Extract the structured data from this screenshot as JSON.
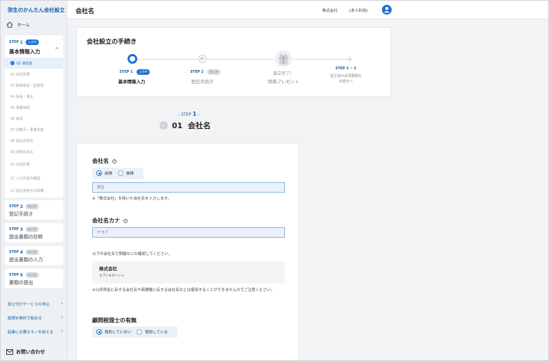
{
  "sidebar": {
    "brand": "弥生のかんたん会社設立",
    "home": "ホーム",
    "step1": {
      "step": "STEP",
      "num": "1",
      "badge": "入力中",
      "title": "基本情報入力",
      "chevron": "^"
    },
    "items": [
      {
        "label": "01 会社名",
        "check": "✓"
      },
      {
        "label": "02 会社形態"
      },
      {
        "label": "03 取締役会・監査役"
      },
      {
        "label": "04 役員・株主"
      },
      {
        "label": "05 事業目的"
      },
      {
        "label": "06 株式"
      },
      {
        "label": "07 決算月・事業年度"
      },
      {
        "label": "08 会社の所在"
      },
      {
        "label": "09 定款の定め"
      },
      {
        "label": "10 日割計算"
      },
      {
        "label": "11 入力内容の確認"
      },
      {
        "label": "12 登記手続きの準備"
      }
    ],
    "steps": [
      {
        "step": "STEP",
        "num": "2",
        "badge": "未入力",
        "title": "登記手続き"
      },
      {
        "step": "STEP",
        "num": "3",
        "badge": "未入力",
        "title": "提出書類の診断"
      },
      {
        "step": "STEP",
        "num": "4",
        "badge": "未入力",
        "title": "提出書類の入力"
      },
      {
        "step": "STEP",
        "num": "5",
        "badge": "未入力",
        "title": "書類の提出"
      }
    ],
    "links": [
      {
        "label": "設立代行サービスの申込",
        "arrow": "›"
      },
      {
        "label": "経理を無料で始める",
        "arrow": "›"
      },
      {
        "label": "起業に必要なモノを揃える",
        "arrow": "›"
      }
    ],
    "contact": "お問い合わせ"
  },
  "topbar": {
    "title": "会社名",
    "company": "株式会社",
    "role": "[本人利用]"
  },
  "process": {
    "title": "会社設立の手続き",
    "steps": [
      {
        "step": "STEP",
        "num": "1",
        "badge": "入力中",
        "label": "基本情報入力"
      },
      {
        "step": "STEP",
        "num": "2",
        "badge": "未入力",
        "label": "登記手続き"
      },
      {
        "line1": "設立完了！",
        "line2": "特典プレゼント"
      },
      {
        "step": "STEP",
        "num": "3 ~ 5",
        "line1": "設立後の必須書類の",
        "line2": "手続きへ"
      }
    ]
  },
  "main": {
    "step_prefix": "- STEP",
    "step_num": "1",
    "step_suffix": "-",
    "section_num": "01",
    "section_title": "会社名",
    "check": "✓",
    "company_name": {
      "label": "会社名",
      "info": "?",
      "radio_options": [
        "前株",
        "後株"
      ],
      "selected": "前株",
      "placeholder": "弥生",
      "note": "※「株式会社」を除いた会社名を入力します。"
    },
    "company_kana": {
      "label": "会社名カナ",
      "info": "?",
      "placeholder": "ヤヨイ"
    },
    "confirm_text": "以下の会社名で問題ないか確認してください。",
    "preview": {
      "name": "株式会社",
      "kana": "カブシキガイシャ"
    },
    "warning": "※公序良俗に反する会社名や商標権に反する会社名などは使用することができませんのでご注意ください。",
    "advisor": {
      "label": "顧問税理士の有無",
      "options": [
        "契約していない",
        "契約している"
      ],
      "selected": "契約していない"
    }
  },
  "colors": {
    "accent": "#1f6fd1",
    "brand": "#1c5fae",
    "input_bg": "#eaf1fa"
  }
}
